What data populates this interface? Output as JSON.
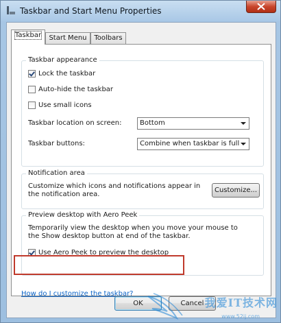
{
  "window": {
    "title": "Taskbar and Start Menu Properties"
  },
  "tabs": [
    {
      "label": "Taskbar",
      "active": true
    },
    {
      "label": "Start Menu",
      "active": false
    },
    {
      "label": "Toolbars",
      "active": false
    }
  ],
  "appearance": {
    "group_title": "Taskbar appearance",
    "lock_label": "Lock the taskbar",
    "lock_checked": true,
    "autohide_label": "Auto-hide the taskbar",
    "autohide_checked": false,
    "small_icons_label": "Use small icons",
    "small_icons_checked": false,
    "location_label": "Taskbar location on screen:",
    "location_value": "Bottom",
    "buttons_label": "Taskbar buttons:",
    "buttons_value": "Combine when taskbar is full"
  },
  "notification": {
    "group_title": "Notification area",
    "description": "Customize which icons and notifications appear in the notification area.",
    "customize_label": "Customize..."
  },
  "aero_peek": {
    "group_title": "Preview desktop with Aero Peek",
    "description": "Temporarily view the desktop when you move your mouse to the Show desktop button at end of the taskbar.",
    "use_label": "Use Aero Peek to preview the desktop",
    "use_checked": true
  },
  "help_link": "How do I customize the taskbar?",
  "footer": {
    "ok_label": "OK",
    "cancel_label": "Cancel"
  },
  "watermark": {
    "text": "我爱IT技术网",
    "url": "www.52ij.com"
  },
  "colors": {
    "highlight": "#c0392b",
    "link": "#0b63c6",
    "close_button": "#c9462c"
  }
}
